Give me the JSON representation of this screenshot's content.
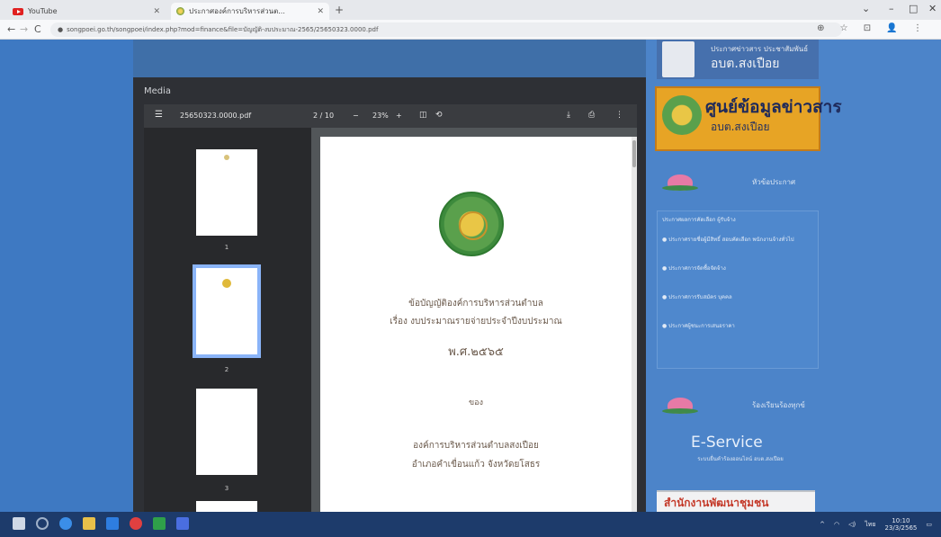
{
  "browser": {
    "tabs": [
      {
        "label": "YouTube"
      },
      {
        "label": "ประกาศองค์การบริหารส่วนต..."
      }
    ],
    "new_tab": "+",
    "window_controls": [
      "⌄",
      "–",
      "□",
      "✕"
    ],
    "nav": {
      "back": "←",
      "forward": "→",
      "reload": "C"
    },
    "address": "songpoei.go.th/songpoei/index.php?mod=finance&file=บัญญัติ-งบประมาณ-2565/25650323.0000.pdf",
    "right_icons": "⊕ ☆ ⊡ 👤 ⋮"
  },
  "modal": {
    "title": "Media",
    "pdf": {
      "filename": "25650323.0000.pdf",
      "page_indicator": "2 / 10",
      "zoom": "23%",
      "minus": "−",
      "plus": "+",
      "thumb_numbers": [
        "1",
        "2",
        "3"
      ]
    },
    "document": {
      "line1": "ข้อบัญญัติองค์การบริหารส่วนตำบล",
      "line2": "เรื่อง งบประมาณรายจ่ายประจำปีงบประมาณ",
      "line3": "พ.ศ.๒๕๖๕",
      "line4": "ของ",
      "line5": "องค์การบริหารส่วนตำบลสงเปือย",
      "line6": "อำเภอคำเขื่อนแก้ว  จังหวัดยโสธร"
    }
  },
  "sidebar": {
    "banner1_small": "ประกาศข่าวสาร ประชาสัมพันธ์",
    "banner1_main": "อบต.สงเปือย",
    "banner2_title": "ศูนย์ข้อมูลข่าวสาร",
    "banner2_sub": "อบต.สงเปือย",
    "head1": "หัวข้อประกาศ",
    "links": [
      "ประกาศผลการคัดเลือก ผู้รับจ้าง",
      "● ประกาศรายชื่อผู้มีสิทธิ์ สอบคัดเลือก พนักงานจ้างทั่วไป",
      "● ประกาศการจัดซื้อจัดจ้าง",
      "● ประกาศการรับสมัคร บุคคล",
      "● ประกาศผู้ชนะการเสนอราคา"
    ],
    "head2": "ร้องเรียนร้องทุกข์",
    "eservice": "E-Service",
    "eservice_desc": "ระบบยื่นคำร้องออนไลน์ อบต.สงเปือย",
    "banner3": "สำนักงานพัฒนาชุมชน"
  },
  "taskbar": {
    "tray_text": "ไทย",
    "time": "10:10",
    "date": "23/3/2565"
  }
}
